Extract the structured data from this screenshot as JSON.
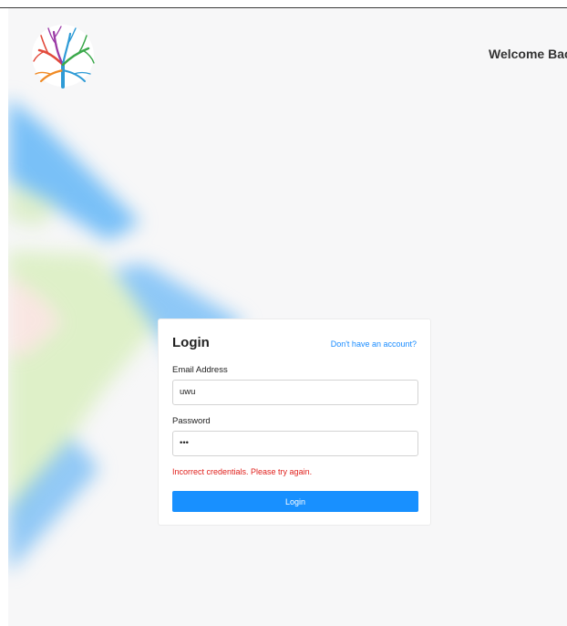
{
  "header": {
    "logo_icon": "tree-logo-icon",
    "welcome_text": "Welcome Back"
  },
  "login_card": {
    "title": "Login",
    "signup_link": "Don't have an account?",
    "email": {
      "label": "Email Address",
      "value": "uwu"
    },
    "password": {
      "label": "Password",
      "value": "•••"
    },
    "error_message": "Incorrect credentials. Please try again.",
    "submit_label": "Login"
  },
  "colors": {
    "accent": "#1890ff",
    "error": "#e0201c",
    "link": "#1a8cff",
    "background": "#f7f7f8"
  }
}
